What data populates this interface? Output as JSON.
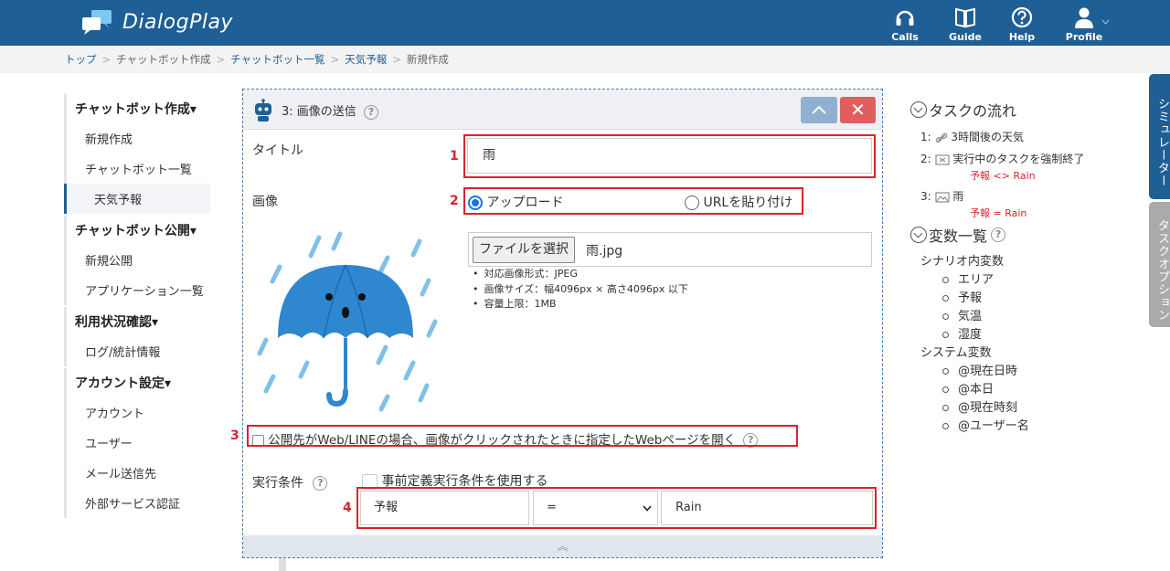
{
  "header": {
    "brand": "DialogPlay",
    "nav": [
      {
        "label": "Calls",
        "icon": "headset-icon"
      },
      {
        "label": "Guide",
        "icon": "book-icon"
      },
      {
        "label": "Help",
        "icon": "question-icon"
      },
      {
        "label": "Profile",
        "icon": "user-icon"
      }
    ],
    "colors": {
      "bar": "#1e5f95"
    }
  },
  "breadcrumb": [
    "トップ",
    "チャットボット作成",
    "チャットボット一覧",
    "天気予報",
    "新規作成"
  ],
  "sidebar": {
    "sections": [
      {
        "title": "チャットボット作成▾",
        "items": [
          "新規作成",
          "チャットボット一覧",
          "天気予報"
        ]
      },
      {
        "title": "チャットボット公開▾",
        "items": [
          "新規公開",
          "アプリケーション一覧"
        ]
      },
      {
        "title": "利用状況確認▾",
        "items": [
          "ログ/統計情報"
        ]
      },
      {
        "title": "アカウント設定▾",
        "items": [
          "アカウント",
          "ユーザー",
          "メール送信先",
          "外部サービス認証"
        ]
      }
    ]
  },
  "panel": {
    "title": "3: 画像の送信",
    "help": "?",
    "close": "✕",
    "title_label": "タイトル",
    "title_value": "雨",
    "image_label": "画像",
    "radio_upload": "アップロード",
    "radio_url": "URLを貼り付け",
    "file_button": "ファイルを選択",
    "file_name": "雨.jpg",
    "notes": [
      "対応画像形式：JPEG",
      "画像サイズ：幅4096px × 高さ4096px 以下",
      "容量上限：1MB"
    ],
    "open_link_label": "公開先がWeb/LINEの場合、画像がクリックされたときに指定したWebページを開く",
    "exec_label": "実行条件",
    "predefined_label": "事前定義実行条件を使用する",
    "cond_var": "予報",
    "cond_op": "=",
    "cond_value": "Rain",
    "markers": [
      "1",
      "2",
      "3",
      "4"
    ],
    "footer": "︽"
  },
  "right": {
    "task_title": "タスクの流れ",
    "tasks": [
      {
        "num": "1:",
        "label": "3時間後の天気",
        "cond": ""
      },
      {
        "num": "2:",
        "label": "実行中のタスクを強制終了",
        "cond": "予報 <> Rain"
      },
      {
        "num": "3:",
        "label": "雨",
        "cond": "予報 = Rain"
      }
    ],
    "vars_title": "変数一覧",
    "scenario_label": "シナリオ内変数",
    "scenario_vars": [
      "エリア",
      "予報",
      "気温",
      "湿度"
    ],
    "system_label": "システム変数",
    "system_vars": [
      "@現在日時",
      "@本日",
      "@現在時刻",
      "@ユーザー名"
    ]
  },
  "tabs": {
    "simulator": "シミュレーター",
    "task_option": "タスクオプション"
  }
}
